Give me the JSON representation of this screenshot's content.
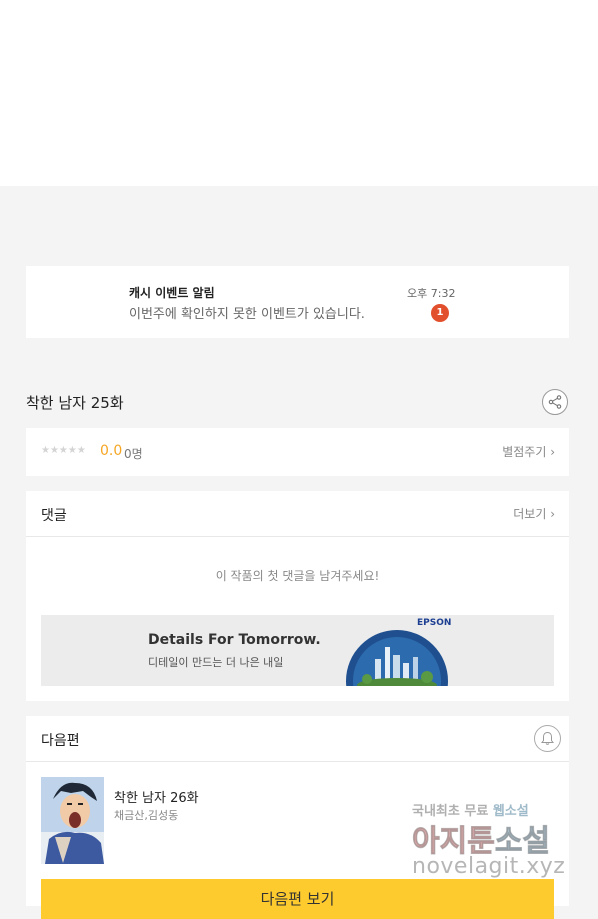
{
  "notification": {
    "title": "캐시 이벤트 알림",
    "message": "이번주에 확인하지 못한 이벤트가 있습니다.",
    "time": "오후 7:32",
    "badge": "1"
  },
  "episode": {
    "title": "착한 남자 25화",
    "rating": {
      "stars": "★★★★★",
      "score": "0.0",
      "count": "0명",
      "rate_label": "별점주기 ›"
    }
  },
  "comments": {
    "title": "댓글",
    "more_label": "더보기 ›",
    "empty_message": "이 작품의 첫 댓글을 남겨주세요!"
  },
  "ad": {
    "headline": "Details For Tomorrow.",
    "subline": "디테일이 만드는 더 나은 내일",
    "brand": "EPSON"
  },
  "next_episode": {
    "section_title": "다음편",
    "title": "착한 남자 26화",
    "authors": "채금산,김성동",
    "button_label": "다음편 보기"
  },
  "watermark": {
    "top_left": "국내최초 무료",
    "top_right": "웹소설",
    "middle_left": "아지툰",
    "middle_right": "소설",
    "bottom": "novelagit.xyz"
  },
  "colors": {
    "accent_yellow": "#fecb2e",
    "badge_red": "#e24f2c",
    "score_orange": "#f5a623"
  }
}
